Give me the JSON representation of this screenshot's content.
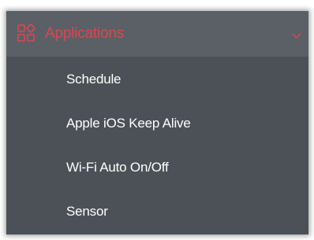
{
  "menu": {
    "header_label": "Applications",
    "header_icon": "apps-grid-icon",
    "accent_color": "#e0454e",
    "panel_bg": "#4b5157",
    "items": [
      {
        "label": "Schedule"
      },
      {
        "label": "Apple iOS Keep Alive"
      },
      {
        "label": "Wi-Fi Auto On/Off"
      },
      {
        "label": "Sensor"
      }
    ]
  }
}
